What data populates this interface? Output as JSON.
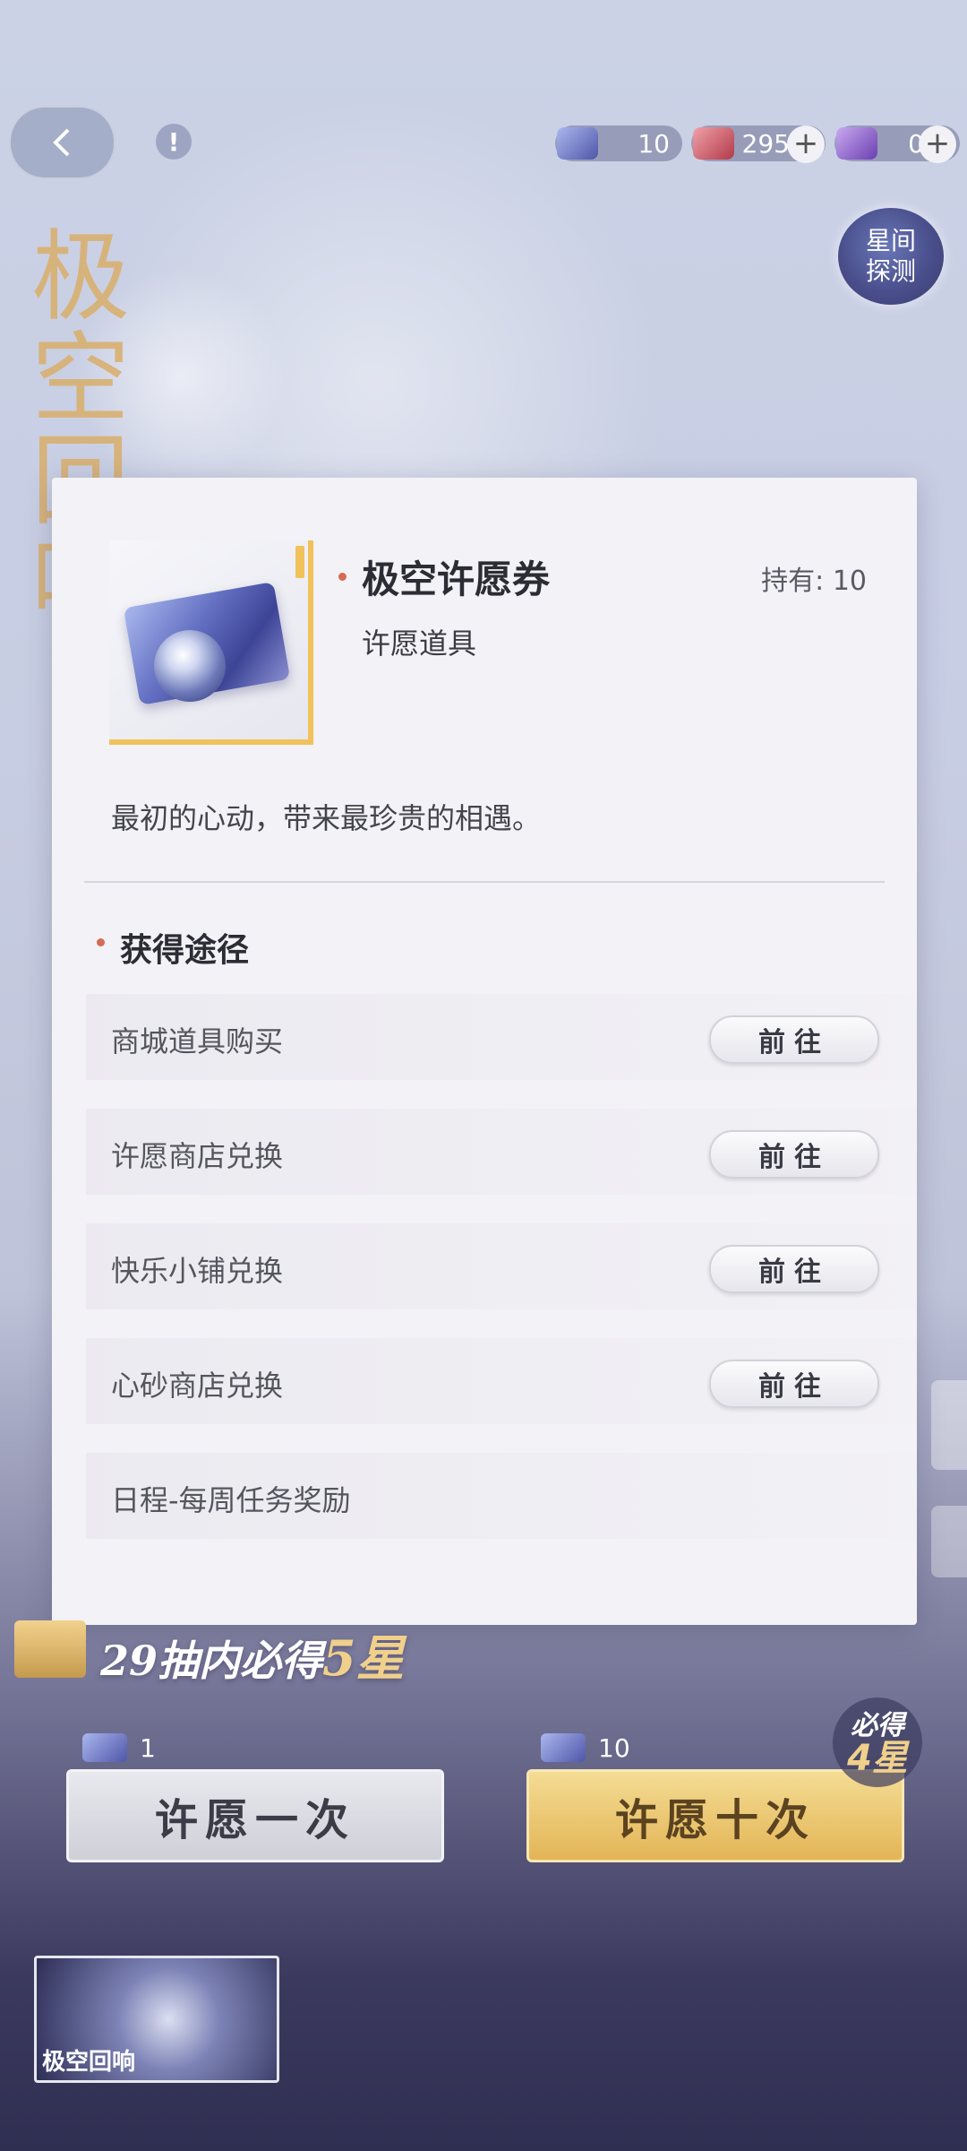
{
  "header": {
    "banner_title": "极空回响",
    "resources": [
      {
        "name": "ticket-resource",
        "value": "10"
      },
      {
        "name": "diamond-resource",
        "value": "295"
      },
      {
        "name": "crystal-resource",
        "value": "0"
      }
    ],
    "star_probe_line1": "星间",
    "star_probe_line2": "探测"
  },
  "modal": {
    "item_name": "极空许愿券",
    "item_type": "许愿道具",
    "held_label": "持有: 10",
    "description": "最初的心动，带来最珍贵的相遇。",
    "section_title": "获得途径",
    "routes": [
      {
        "label": "商城道具购买",
        "button": "前往"
      },
      {
        "label": "许愿商店兑换",
        "button": "前往"
      },
      {
        "label": "快乐小铺兑换",
        "button": "前往"
      },
      {
        "label": "心砂商店兑换",
        "button": "前往"
      },
      {
        "label": "日程-每周任务奖励",
        "button": ""
      }
    ]
  },
  "bottom": {
    "pity_text_a": "29抽内必得",
    "pity_text_b": "5星",
    "wish_one": {
      "cost": "1",
      "label": "许愿一次"
    },
    "wish_ten": {
      "cost": "10",
      "label": "许愿十次"
    },
    "must_line1": "必得",
    "must_line2": "4星",
    "banner_thumb_label": "极空回响"
  },
  "colors": {
    "accent_gold": "#f1c15a",
    "dot_red": "#d56a55"
  }
}
